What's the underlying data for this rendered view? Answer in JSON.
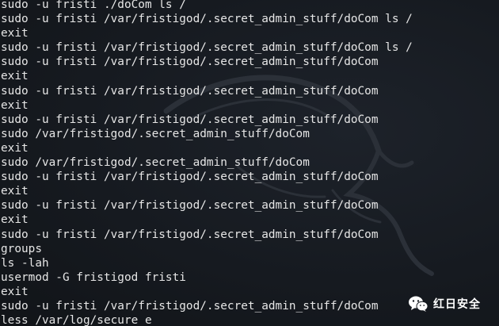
{
  "terminal": {
    "lines": [
      "sudo -u fristi ./doCom ls /",
      "sudo -u fristi /var/fristigod/.secret_admin_stuff/doCom ls /",
      "exit",
      "sudo -u fristi /var/fristigod/.secret_admin_stuff/doCom ls /",
      "sudo -u fristi /var/fristigod/.secret_admin_stuff/doCom",
      "exit",
      "sudo -u fristi /var/fristigod/.secret_admin_stuff/doCom",
      "exit",
      "sudo -u fristi /var/fristigod/.secret_admin_stuff/doCom",
      "sudo /var/fristigod/.secret_admin_stuff/doCom",
      "exit",
      "sudo /var/fristigod/.secret_admin_stuff/doCom",
      "sudo -u fristi /var/fristigod/.secret_admin_stuff/doCom",
      "exit",
      "sudo -u fristi /var/fristigod/.secret_admin_stuff/doCom",
      "exit",
      "sudo -u fristi /var/fristigod/.secret_admin_stuff/doCom",
      "groups",
      "ls -lah",
      "usermod -G fristigod fristi",
      "exit",
      "sudo -u fristi /var/fristigod/.secret_admin_stuff/doCom",
      "less /var/log/secure e"
    ],
    "text_color": "#e6e6e6",
    "background_color": "#15191f"
  },
  "watermark": {
    "icon": "wechat-icon",
    "label": "红日安全"
  }
}
